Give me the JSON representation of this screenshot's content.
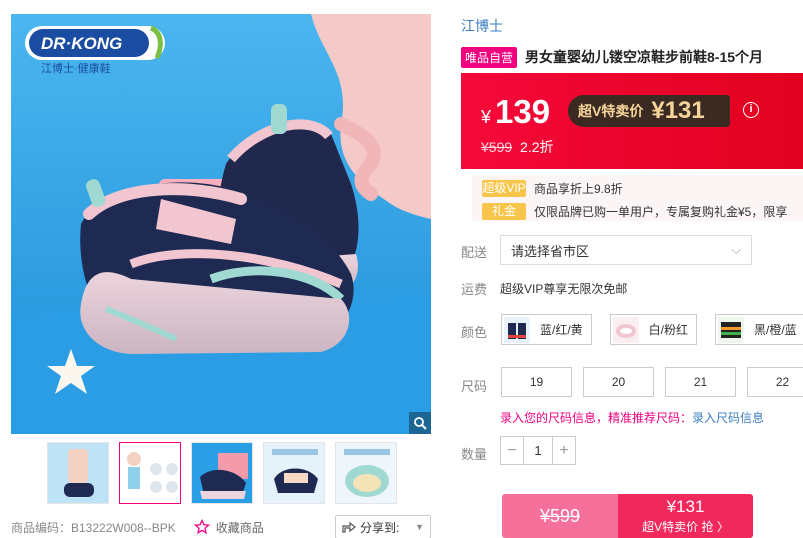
{
  "logo": {
    "brand_en": "DR·KONG",
    "brand_cn": "江博士·健康鞋"
  },
  "product": {
    "brand": "江博士",
    "tag": "唯品自营",
    "title": "男女童婴幼儿镂空凉鞋步前鞋8-15个月"
  },
  "price": {
    "currency": "¥",
    "current": "139",
    "vip_label": "超V特卖价",
    "vip_price": "¥131",
    "info_icon": "i",
    "original": "¥599",
    "discount": "2.2折"
  },
  "promos": [
    {
      "tag": "超级VIP",
      "text": "商品享折上9.8折"
    },
    {
      "tag": "礼金",
      "text": "仅限品牌已购一单用户，专属复购礼金¥5，限享"
    }
  ],
  "delivery": {
    "label": "配送",
    "placeholder": "请选择省市区"
  },
  "shipping": {
    "label": "运费",
    "text": "超级VIP尊享无限次免邮"
  },
  "colors": {
    "label": "颜色",
    "options": [
      "蓝/红/黄",
      "白/粉红",
      "黑/橙/蓝"
    ]
  },
  "sizes": {
    "label": "尺码",
    "options": [
      "19",
      "20",
      "21",
      "22"
    ],
    "tip_text": "录入您的尺码信息，精准推荐尺码：",
    "tip_link": "录入尺码信息"
  },
  "quantity": {
    "label": "数量",
    "value": "1",
    "minus": "−",
    "plus": "+"
  },
  "buy": {
    "original": "¥599",
    "price": "¥131",
    "label": "超V特卖价 抢 〉"
  },
  "meta": {
    "code": "商品编码：B13222W008--BPK",
    "favorite": "收藏商品",
    "share": "分享到:"
  },
  "colors_hex": {
    "accent": "#f10180",
    "price_red": "#e1011f",
    "link_blue": "#3d7ebd",
    "vip_gold": "#f7d59a"
  }
}
